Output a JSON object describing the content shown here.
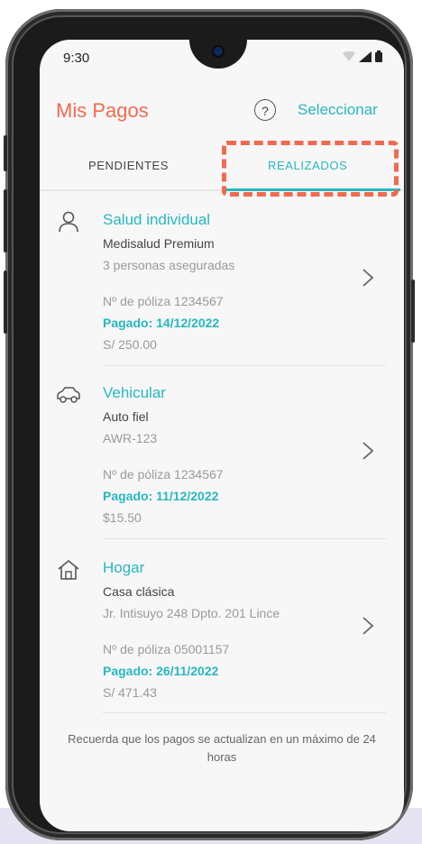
{
  "status_bar": {
    "time": "9:30"
  },
  "header": {
    "title": "Mis Pagos",
    "help_icon": "?",
    "select_label": "Seleccionar"
  },
  "tabs": {
    "pending": "PENDIENTES",
    "done": "REALIZADOS"
  },
  "colors": {
    "accent": "#28b7c0",
    "brand": "#f26a4f",
    "highlight": "#f26a4f"
  },
  "payments": [
    {
      "icon": "person-icon",
      "category": "Salud individual",
      "plan": "Medisalud Premium",
      "detail": "3 personas aseguradas",
      "policy": "Nº de póliza 1234567",
      "paid": "Pagado: 14/12/2022",
      "amount": "S/ 250.00"
    },
    {
      "icon": "car-icon",
      "category": "Vehicular",
      "plan": "Auto fiel",
      "detail": "AWR-123",
      "policy": "Nº de póliza 1234567",
      "paid": "Pagado: 11/12/2022",
      "amount": "$15.50"
    },
    {
      "icon": "home-icon",
      "category": "Hogar",
      "plan": "Casa clásica",
      "detail": "Jr. Intisuyo 248 Dpto. 201 Lince",
      "policy": "Nº de póliza 05001157",
      "paid": "Pagado: 26/11/2022",
      "amount": "S/ 471.43"
    }
  ],
  "footer": {
    "note": "Recuerda que los pagos se actualizan en un máximo de 24 horas"
  }
}
